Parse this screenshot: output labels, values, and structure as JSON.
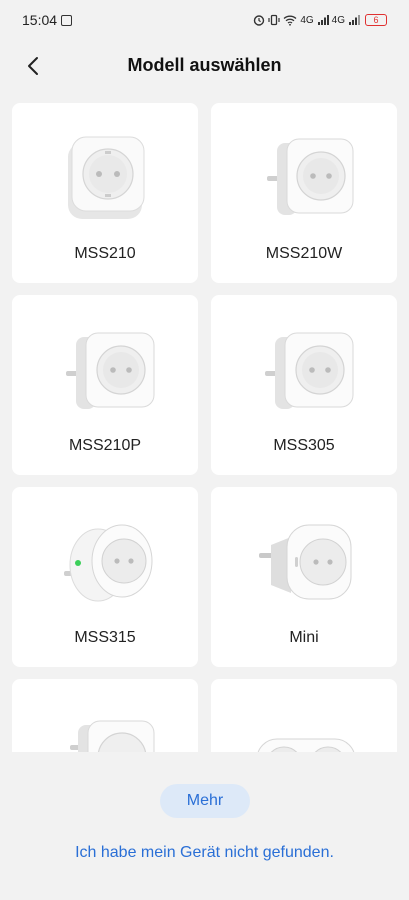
{
  "status_bar": {
    "time": "15:04",
    "network": "4G",
    "battery": "6",
    "battery_color": "#e03030"
  },
  "header": {
    "title": "Modell auswählen",
    "back_icon": "chevron-left-icon"
  },
  "models": [
    {
      "label": "MSS210",
      "image": "smart-plug-square"
    },
    {
      "label": "MSS210W",
      "image": "smart-plug-side"
    },
    {
      "label": "MSS210P",
      "image": "smart-plug-side"
    },
    {
      "label": "MSS305",
      "image": "smart-plug-side"
    },
    {
      "label": "MSS315",
      "image": "smart-plug-round-led"
    },
    {
      "label": "Mini",
      "image": "smart-plug-mini"
    },
    {
      "label": "",
      "image": "smart-plug-side"
    },
    {
      "label": "",
      "image": "smart-plug-double"
    }
  ],
  "actions": {
    "more_label": "Mehr",
    "not_found_label": "Ich habe mein Gerät nicht gefunden."
  },
  "colors": {
    "accent": "#2a6fd6",
    "accent_light": "#dde9f8",
    "background": "#f2f2f2"
  }
}
